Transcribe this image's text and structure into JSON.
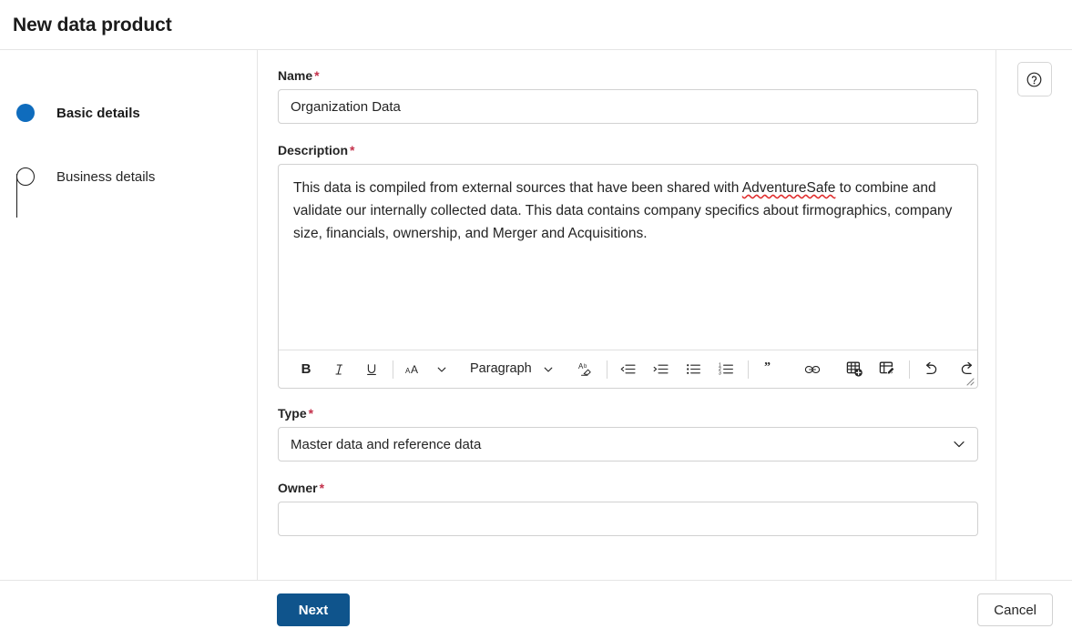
{
  "dialog": {
    "title": "New data product"
  },
  "stepper": {
    "steps": [
      {
        "label": "Basic details",
        "state": "active"
      },
      {
        "label": "Business details",
        "state": "pending"
      }
    ]
  },
  "form": {
    "required_marker": "*",
    "name": {
      "label": "Name",
      "value": "Organization Data",
      "placeholder": "",
      "required": true
    },
    "description": {
      "label": "Description",
      "required": true,
      "text_part1": "This data is compiled from external sources that have been shared with ",
      "text_misspelled": "AdventureSafe",
      "text_part2": " to combine and validate our internally collected data.  This data contains company specifics about firmographics, company size, financials, ownership, and Merger and Acquisitions."
    },
    "type": {
      "label": "Type",
      "value": "Master data and reference data",
      "required": true
    },
    "owner": {
      "label": "Owner",
      "value": "",
      "placeholder": "",
      "required": true
    }
  },
  "editor_toolbar": {
    "bold": {
      "icon": "bold-icon",
      "glyph": "B",
      "title": "Bold"
    },
    "italic": {
      "icon": "italic-icon",
      "glyph": "I",
      "title": "Italic"
    },
    "underline": {
      "icon": "underline-icon",
      "glyph": "U",
      "title": "Underline"
    },
    "font_size": {
      "icon": "font-size-icon",
      "glyph": "aA",
      "title": "Font size"
    },
    "paragraph": {
      "icon": "paragraph-dropdown",
      "label": "Paragraph",
      "title": "Paragraph style"
    },
    "clear_formatting": {
      "icon": "clear-formatting-icon",
      "title": "Clear formatting"
    },
    "decrease_indent": {
      "icon": "decrease-indent-icon",
      "title": "Decrease indent"
    },
    "increase_indent": {
      "icon": "increase-indent-icon",
      "title": "Increase indent"
    },
    "bulleted_list": {
      "icon": "bulleted-list-icon",
      "title": "Bulleted list"
    },
    "numbered_list": {
      "icon": "numbered-list-icon",
      "title": "Numbered list"
    },
    "quote": {
      "icon": "quote-icon",
      "glyph": "”",
      "title": "Quote"
    },
    "link": {
      "icon": "link-icon",
      "title": "Insert link"
    },
    "insert_table": {
      "icon": "insert-table-icon",
      "title": "Insert table"
    },
    "edit_table": {
      "icon": "edit-table-icon",
      "title": "Edit table"
    },
    "undo": {
      "icon": "undo-icon",
      "title": "Undo"
    },
    "redo": {
      "icon": "redo-icon",
      "title": "Redo"
    }
  },
  "help": {
    "icon": "help-question-icon",
    "title": "Help"
  },
  "footer": {
    "next_label": "Next",
    "cancel_label": "Cancel"
  },
  "colors": {
    "accent_blue": "#0f6cbd",
    "primary_button": "#0f548c",
    "required_red": "#c4314b",
    "spellcheck_red": "#e02b2b",
    "border": "#d1d1d1",
    "divider": "#e5e5e5"
  }
}
